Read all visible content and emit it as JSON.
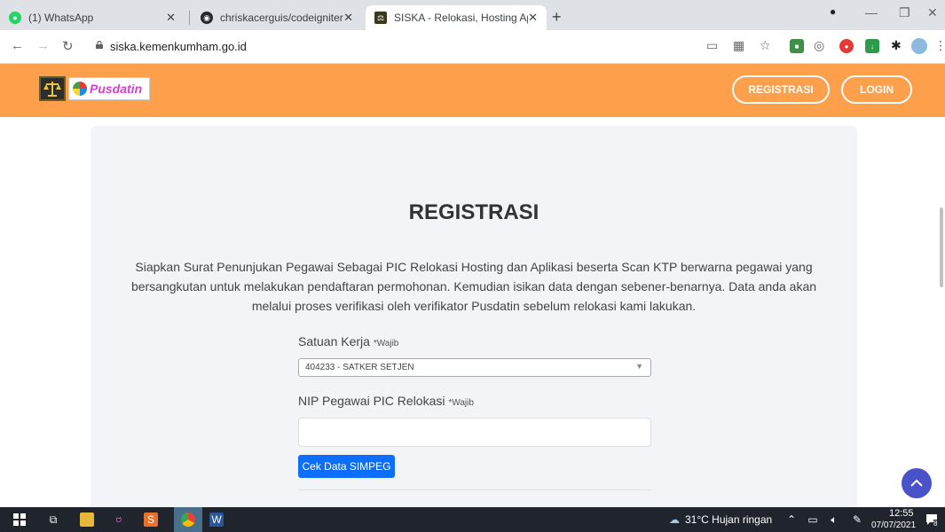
{
  "browser": {
    "tabs": [
      {
        "title": "(1) WhatsApp",
        "favicon": "whatsapp-icon"
      },
      {
        "title": "chriskacerguis/codeigniter-restse",
        "favicon": "github-icon"
      },
      {
        "title": "SISKA - Relokasi, Hosting Aplikasi",
        "favicon": "siska-icon"
      }
    ],
    "url": "siska.kemenkumham.go.id"
  },
  "header": {
    "logo_text": "Pusdatin",
    "register_label": "REGISTRASI",
    "login_label": "LOGIN",
    "color": "#fd9f4b"
  },
  "form": {
    "title": "REGISTRASI",
    "description": "Siapkan Surat Penunjukan Pegawai Sebagai PIC Relokasi Hosting dan Aplikasi beserta Scan KTP berwarna pegawai yang bersangkutan untuk melakukan pendaftaran permohonan. Kemudian isikan data dengan sebener-benarnya. Data anda akan melalui proses verifikasi oleh verifikator Pusdatin sebelum relokasi kami lakukan.",
    "satker_label": "Satuan Kerja",
    "required_mark": "*Wajib",
    "satker_value": "404233 - SATKER SETJEN",
    "nip_label": "NIP Pegawai PIC Relokasi",
    "nip_value": "",
    "check_button": "Cek Data SIMPEG"
  },
  "taskbar": {
    "weather": "31°C  Hujan ringan",
    "time": "12:55",
    "date": "07/07/2021",
    "notif_count": "8"
  }
}
